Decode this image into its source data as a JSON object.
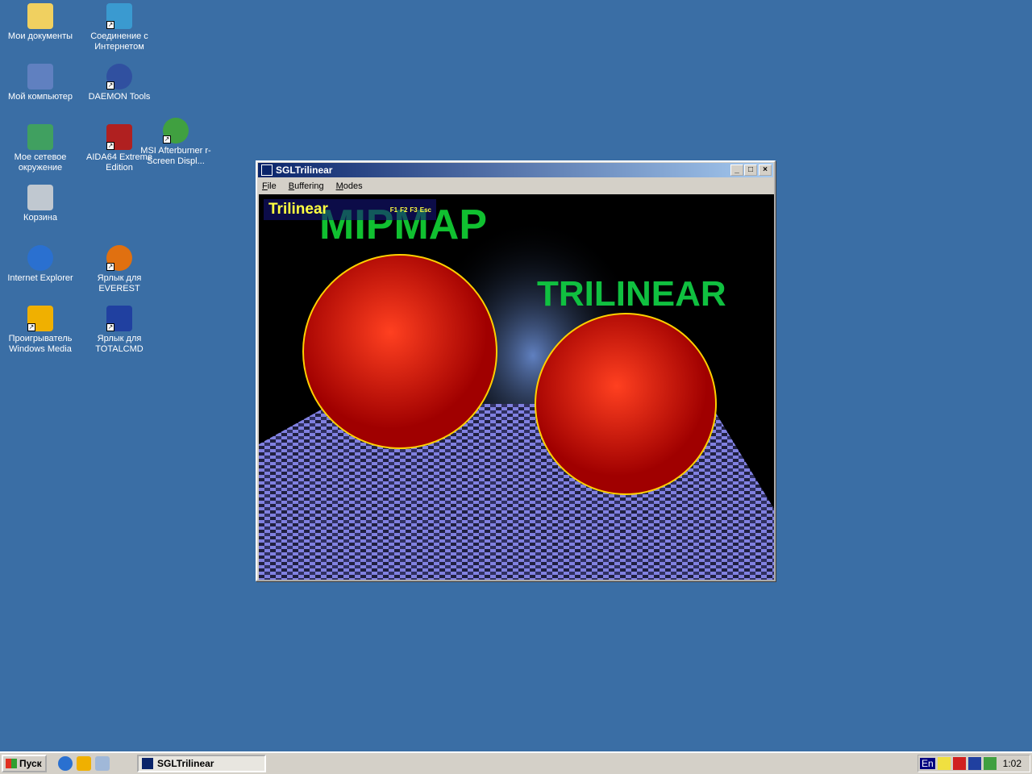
{
  "desktop": {
    "icons": [
      {
        "label": "Мои документы",
        "color": "#f0d060"
      },
      {
        "label": "Соединение с Интернетом",
        "color": "#3a9ad0"
      },
      {
        "label": "Мой компьютер",
        "color": "#6080c0"
      },
      {
        "label": "DAEMON Tools",
        "color": "#3050a0"
      },
      {
        "label": "Мое сетевое окружение",
        "color": "#40a060"
      },
      {
        "label": "AIDA64 Extreme Edition",
        "color": "#b02020"
      },
      {
        "label": "MSI Afterburner r-Screen Displ...",
        "color": "#40a040"
      },
      {
        "label": "Корзина",
        "color": "#c0c8d0"
      },
      {
        "label": "Internet Explorer",
        "color": "#2a70d0"
      },
      {
        "label": "Ярлык для EVEREST",
        "color": "#e07010"
      },
      {
        "label": "Проигрыватель Windows Media",
        "color": "#f0b000"
      },
      {
        "label": "Ярлык для TOTALCMD",
        "color": "#2040a0"
      }
    ]
  },
  "window": {
    "title": "SGLTrilinear",
    "menu": [
      "File",
      "Buffering",
      "Modes"
    ],
    "scene": {
      "mode_label": "Trilinear",
      "keys": [
        "F1",
        "F2",
        "F3",
        "Esc"
      ],
      "text_mipmap": "MIPMAP",
      "text_trilinear": "TRILINEAR"
    }
  },
  "taskbar": {
    "start": "Пуск",
    "task": "SGLTrilinear",
    "lang": "En",
    "clock": "1:02"
  }
}
